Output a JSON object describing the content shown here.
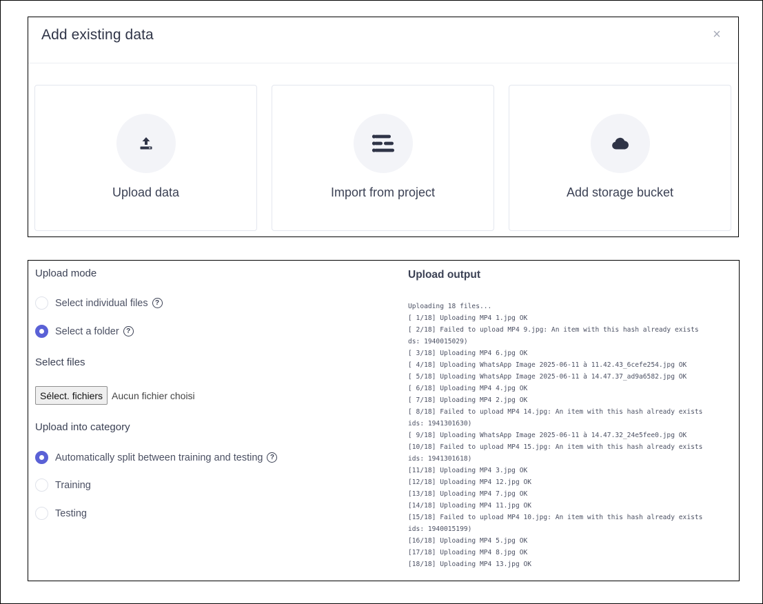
{
  "dialog": {
    "title": "Add existing data",
    "close_label": "×",
    "options": [
      {
        "label": "Upload data",
        "icon": "upload-icon"
      },
      {
        "label": "Import from project",
        "icon": "list-icon"
      },
      {
        "label": "Add storage bucket",
        "icon": "cloud-icon"
      }
    ]
  },
  "upload": {
    "mode_heading": "Upload mode",
    "modes": [
      {
        "label": "Select individual files",
        "checked": false
      },
      {
        "label": "Select a folder",
        "checked": true
      }
    ],
    "files_heading": "Select files",
    "file_button_label": "Sélect. fichiers",
    "file_status": "Aucun fichier choisi",
    "category_heading": "Upload into category",
    "categories": [
      {
        "label": "Automatically split between training and testing",
        "checked": true
      },
      {
        "label": "Training",
        "checked": false
      },
      {
        "label": "Testing",
        "checked": false
      }
    ],
    "output_title": "Upload output",
    "output_lines": [
      "Uploading 18 files...",
      "[ 1/18] Uploading MP4 1.jpg OK",
      "[ 2/18] Failed to upload MP4 9.jpg: An item with this hash already exists",
      "ds: 1940015029)",
      "[ 3/18] Uploading MP4 6.jpg OK",
      "[ 4/18] Uploading WhatsApp Image 2025-06-11 à 11.42.43_6cefe254.jpg OK",
      "[ 5/18] Uploading WhatsApp Image 2025-06-11 à 14.47.37_ad9a6582.jpg OK",
      "[ 6/18] Uploading MP4 4.jpg OK",
      "[ 7/18] Uploading MP4 2.jpg OK",
      "[ 8/18] Failed to upload MP4 14.jpg: An item with this hash already exists",
      "ids: 1941301630)",
      "[ 9/18] Uploading WhatsApp Image 2025-06-11 à 14.47.32_24e5fee0.jpg OK",
      "[10/18] Failed to upload MP4 15.jpg: An item with this hash already exists",
      "ids: 1941301618)",
      "[11/18] Uploading MP4 3.jpg OK",
      "[12/18] Uploading MP4 12.jpg OK",
      "[13/18] Uploading MP4 7.jpg OK",
      "[14/18] Uploading MP4 11.jpg OK",
      "[15/18] Failed to upload MP4 10.jpg: An item with this hash already exists",
      "ids: 1940015199)",
      "[16/18] Uploading MP4 5.jpg OK",
      "[17/18] Uploading MP4 8.jpg OK",
      "[18/18] Uploading MP4 13.jpg OK"
    ]
  },
  "colors": {
    "accent": "#5a61d6",
    "icon_dark": "#2f3447",
    "icon_circle": "#f3f4f8"
  }
}
